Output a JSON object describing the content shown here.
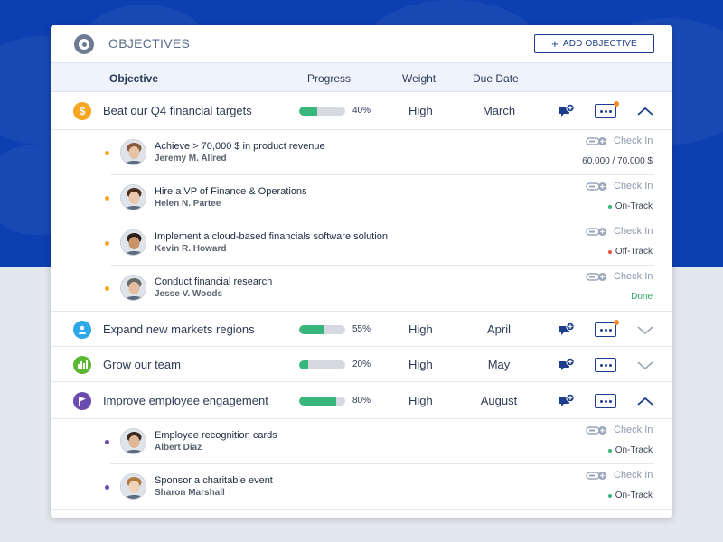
{
  "header": {
    "title": "OBJECTIVES",
    "add_button": "ADD OBJECTIVE"
  },
  "columns": {
    "objective": "Objective",
    "progress": "Progress",
    "weight": "Weight",
    "due_date": "Due Date"
  },
  "objectives": [
    {
      "title": "Beat our Q4 financial targets",
      "icon": "dollar-icon",
      "icon_color": "#f5a623",
      "progress_percent": 40,
      "progress_text": "40%",
      "weight": "High",
      "due": "March",
      "expanded": true,
      "has_notification": true,
      "subs": [
        {
          "title": "Achieve > 70,000 $ in product revenue",
          "owner": "Jeremy M. Allred",
          "checkin": "Check In",
          "status": "60,000 / 70,000 $",
          "status_color": "#3d4657",
          "dot_color": "#f5a623"
        },
        {
          "title": "Hire a VP of Finance & Operations",
          "owner": "Helen N. Partee",
          "checkin": "Check In",
          "status": "On-Track",
          "status_color": "#3d4657",
          "status_dot": "#38b67b",
          "dot_color": "#f5a623"
        },
        {
          "title": "Implement a cloud-based financials software solution",
          "owner": "Kevin R. Howard",
          "checkin": "Check In",
          "status": "Off-Track",
          "status_color": "#3d4657",
          "status_dot": "#e5533d",
          "dot_color": "#f5a623"
        },
        {
          "title": "Conduct financial research",
          "owner": "Jesse V. Woods",
          "checkin": "Check In",
          "status": "Done",
          "status_color": "#2bab5f",
          "dot_color": "#f5a623"
        }
      ]
    },
    {
      "title": "Expand new markets regions",
      "icon": "person-icon",
      "icon_color": "#2fa8e8",
      "progress_percent": 55,
      "progress_text": "55%",
      "weight": "High",
      "due": "April",
      "expanded": false,
      "has_notification": true,
      "subs": []
    },
    {
      "title": "Grow our team",
      "icon": "bar-chart-icon",
      "icon_color": "#5cb833",
      "progress_percent": 20,
      "progress_text": "20%",
      "weight": "High",
      "due": "May",
      "expanded": false,
      "has_notification": false,
      "subs": []
    },
    {
      "title": "Improve employee engagement",
      "icon": "flag-icon",
      "icon_color": "#6a4bb0",
      "progress_percent": 80,
      "progress_text": "80%",
      "weight": "High",
      "due": "August",
      "expanded": true,
      "has_notification": false,
      "subs": [
        {
          "title": "Employee recognition cards",
          "owner": "Albert Diaz",
          "checkin": "Check In",
          "status": "On-Track",
          "status_color": "#3d4657",
          "status_dot": "#38b67b",
          "dot_color": "#6a4bb0"
        },
        {
          "title": "Sponsor a charitable event",
          "owner": "Sharon Marshall",
          "checkin": "Check In",
          "status": "On-Track",
          "status_color": "#3d4657",
          "status_dot": "#38b67b",
          "dot_color": "#6a4bb0"
        }
      ]
    }
  ]
}
